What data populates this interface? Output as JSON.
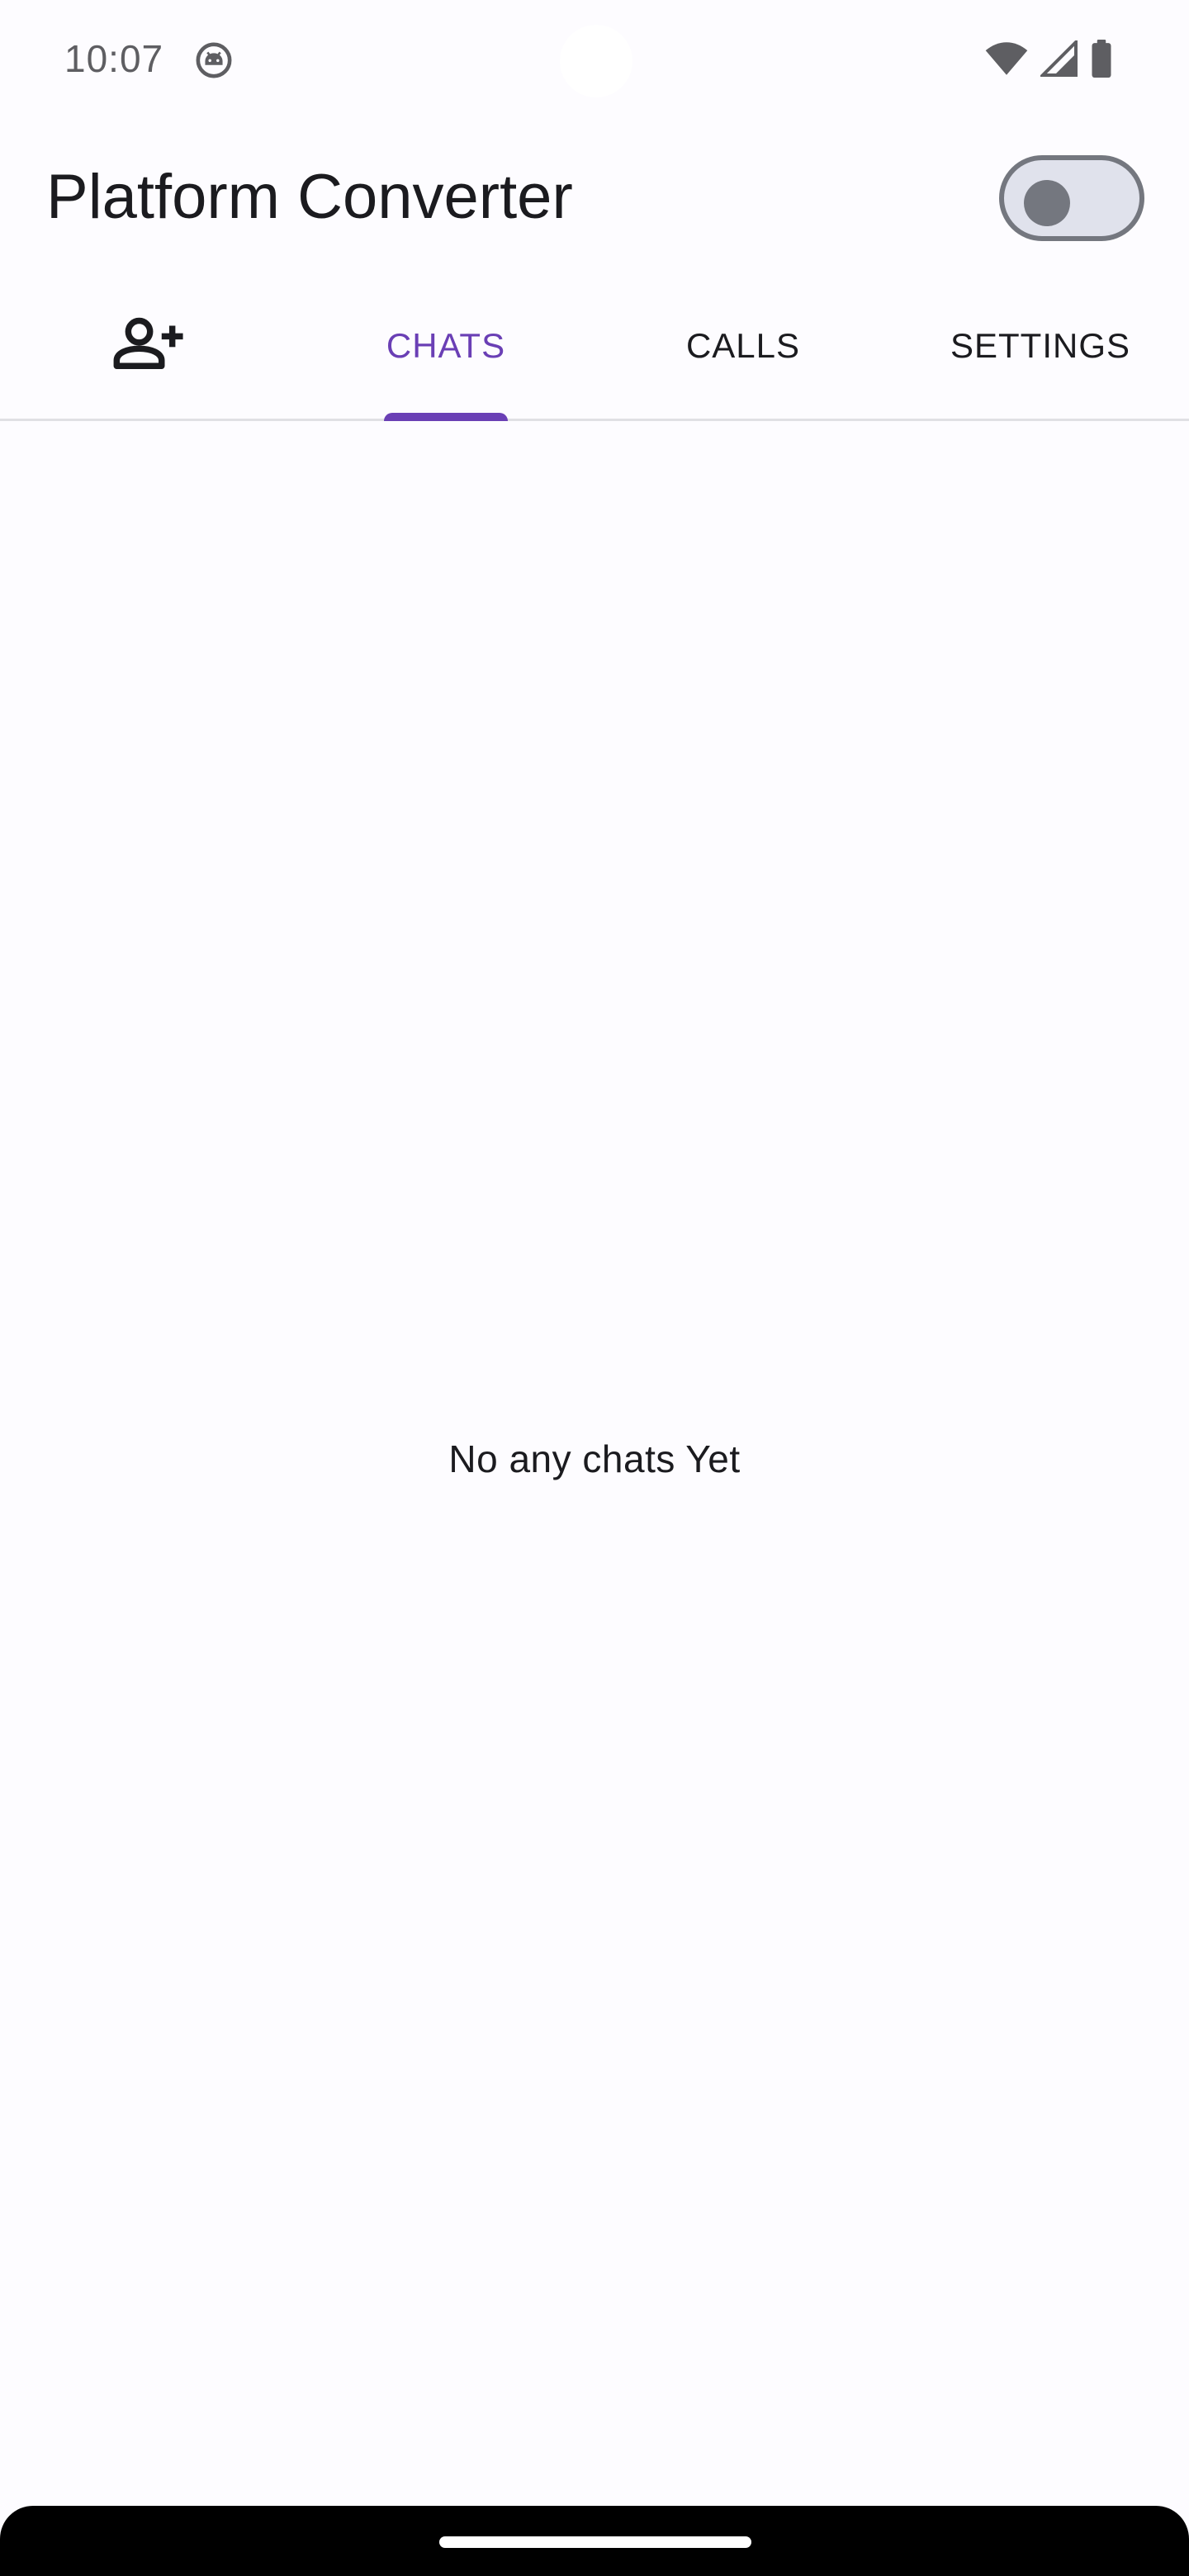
{
  "status_bar": {
    "time": "10:07",
    "notification_icon": "android-debug-icon",
    "wifi_icon": "wifi-icon",
    "signal_icon": "cell-signal-icon",
    "battery_icon": "battery-icon"
  },
  "app_bar": {
    "title": "Platform Converter",
    "toggle_state": "off"
  },
  "tabs": [
    {
      "icon": "person-add-icon",
      "label": "",
      "active": false
    },
    {
      "label": "CHATS",
      "active": true
    },
    {
      "label": "CALLS",
      "active": false
    },
    {
      "label": "SETTINGS",
      "active": false
    }
  ],
  "content": {
    "empty_message": "No any chats Yet"
  },
  "colors": {
    "accent": "#6a3fb5",
    "background": "#fdfcff",
    "text": "#1b1b1f"
  }
}
